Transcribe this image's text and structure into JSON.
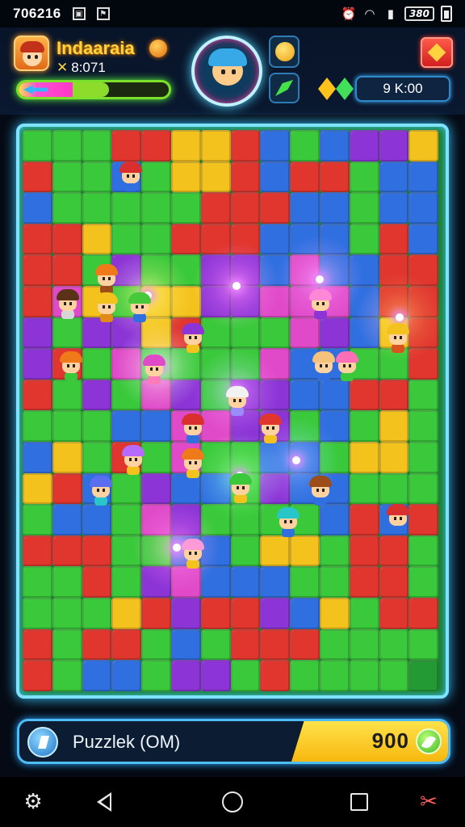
{
  "status_bar": {
    "time": "706216",
    "icons": [
      "image-icon",
      "notification-flag-icon",
      "alarm-icon",
      "wifi-icon",
      "signal-icon"
    ],
    "battery_text": "380"
  },
  "header": {
    "player_name": "Indaaraia",
    "player_score": "8:071",
    "currency_value": "9 K:00",
    "xp_progress": 0.6
  },
  "board": {
    "columns": 14,
    "rows": 18,
    "palette": {
      "r": "#e0362e",
      "g": "#39c93a",
      "b": "#2f6fe0",
      "y": "#f4c21d",
      "p": "#8c34d6",
      "o": "#f07a1a",
      "m": "#e04ac8",
      "c": "#28c6c9",
      "d": "#239a33"
    },
    "pattern": [
      "gggrryyrbgbppy",
      "rggbgyyrbrrgbb",
      "bgggggrrrbbgbb",
      "rryggrrrbbbgrb",
      "rrgpggppbmbbrr",
      "rmygyyppmmmbrr",
      "pgppyrgggmpbyr",
      "prgmggggmbbggr",
      "rgpgmpgppbbrrg",
      "gggbbmmppgbgyg",
      "bygrgmggbbgyyg",
      "yrbgpbbgpbbggg",
      "gbbgmpggggbrbr",
      "rrrggbbgyygrrg",
      "ggrgpmbbbggrrg",
      "gggyrprrpbygrr",
      "rgrrgbgrrrgggg",
      "rgbbgppgrggggd"
    ],
    "characters": [
      {
        "name": "red-mushroom-villager",
        "col": 3.2,
        "row": 1.0,
        "hat": "#d92f2f",
        "body": "#2f6fe0"
      },
      {
        "name": "orange-hat-villager",
        "col": 2.4,
        "row": 4.3,
        "hat": "#f07a1a",
        "body": "#9c4d1a"
      },
      {
        "name": "brown-hair-villager",
        "col": 1.1,
        "row": 5.1,
        "hat": "#5a3217",
        "body": "#d6d6d6"
      },
      {
        "name": "yellow-hat-villager",
        "col": 2.4,
        "row": 5.2,
        "hat": "#f4c21d",
        "body": "#e08a1a"
      },
      {
        "name": "green-cap-villager",
        "col": 3.5,
        "row": 5.2,
        "hat": "#46c93a",
        "body": "#2f6fe0"
      },
      {
        "name": "purple-helmet-villager",
        "col": 5.3,
        "row": 6.2,
        "hat": "#8c34d6",
        "body": "#f4c21d"
      },
      {
        "name": "pink-hat-villager",
        "col": 4.0,
        "row": 7.2,
        "hat": "#e04ac8",
        "body": "#ff7ab8"
      },
      {
        "name": "orange-bandana-villager",
        "col": 1.2,
        "row": 7.1,
        "hat": "#f07a1a",
        "body": "#39c93a"
      },
      {
        "name": "white-ghost-villager",
        "col": 6.8,
        "row": 8.2,
        "hat": "#f2f2f2",
        "body": "#9a8cff"
      },
      {
        "name": "pink-bow-villager",
        "col": 9.6,
        "row": 5.1,
        "hat": "#ff87d8",
        "body": "#8c34d6"
      },
      {
        "name": "gold-crown-villager",
        "col": 12.2,
        "row": 6.2,
        "hat": "#f4c21d",
        "body": "#d9531f"
      },
      {
        "name": "tan-hat-villager",
        "col": 9.7,
        "row": 7.1,
        "hat": "#f4c27a",
        "body": "#2f6fe0"
      },
      {
        "name": "pink-cap-villager",
        "col": 10.5,
        "row": 7.1,
        "hat": "#ff6fb8",
        "body": "#39c93a"
      },
      {
        "name": "red-hood-villager",
        "col": 5.3,
        "row": 9.1,
        "hat": "#d92f2f",
        "body": "#2f6fe0"
      },
      {
        "name": "red-feather-villager",
        "col": 7.9,
        "row": 9.1,
        "hat": "#e0362e",
        "body": "#f4c21d"
      },
      {
        "name": "purple-hat-villager",
        "col": 3.3,
        "row": 10.1,
        "hat": "#b56bff",
        "body": "#f4c21d"
      },
      {
        "name": "orange-ear-villager",
        "col": 5.3,
        "row": 10.2,
        "hat": "#f07a1a",
        "body": "#f4c21d"
      },
      {
        "name": "blue-ghost-villager",
        "col": 2.2,
        "row": 11.1,
        "hat": "#5a6ff0",
        "body": "#28c6c9"
      },
      {
        "name": "green-hair-villager",
        "col": 6.9,
        "row": 11.0,
        "hat": "#39c93a",
        "body": "#f4c21d"
      },
      {
        "name": "brown-cap-villager",
        "col": 9.6,
        "row": 11.1,
        "hat": "#9c4d1a",
        "body": "#2f6fe0"
      },
      {
        "name": "teal-hat-villager",
        "col": 8.5,
        "row": 12.1,
        "hat": "#28c6c9",
        "body": "#2f6fe0"
      },
      {
        "name": "red-mushroom-villager-right",
        "col": 12.2,
        "row": 12.0,
        "hat": "#d92f2f",
        "body": "#2f6fe0"
      },
      {
        "name": "pink-beanie-villager",
        "col": 5.3,
        "row": 13.1,
        "hat": "#ff9ad8",
        "body": "#f4c21d"
      }
    ],
    "glows": [
      {
        "col": 4.2,
        "row": 5.3,
        "color": "#ffe96a"
      },
      {
        "col": 7.2,
        "row": 5.0,
        "color": "#ff66ff"
      },
      {
        "col": 10.0,
        "row": 4.8,
        "color": "#d56bff"
      },
      {
        "col": 4.6,
        "row": 7.6,
        "color": "#ffffff"
      },
      {
        "col": 7.2,
        "row": 8.4,
        "color": "#c06bff"
      },
      {
        "col": 7.3,
        "row": 11.1,
        "color": "#7dff7d"
      },
      {
        "col": 5.2,
        "row": 13.4,
        "color": "#ff5fd0"
      },
      {
        "col": 9.2,
        "row": 10.6,
        "color": "#7d7dff"
      },
      {
        "col": 12.7,
        "row": 6.0,
        "color": "#ff8a3a"
      }
    ]
  },
  "bottom_bar": {
    "label": "Puzzlek (OM)",
    "score": "900"
  },
  "navbar": {
    "items": [
      "settings-shortcut",
      "back",
      "home",
      "recents",
      "tools"
    ]
  }
}
